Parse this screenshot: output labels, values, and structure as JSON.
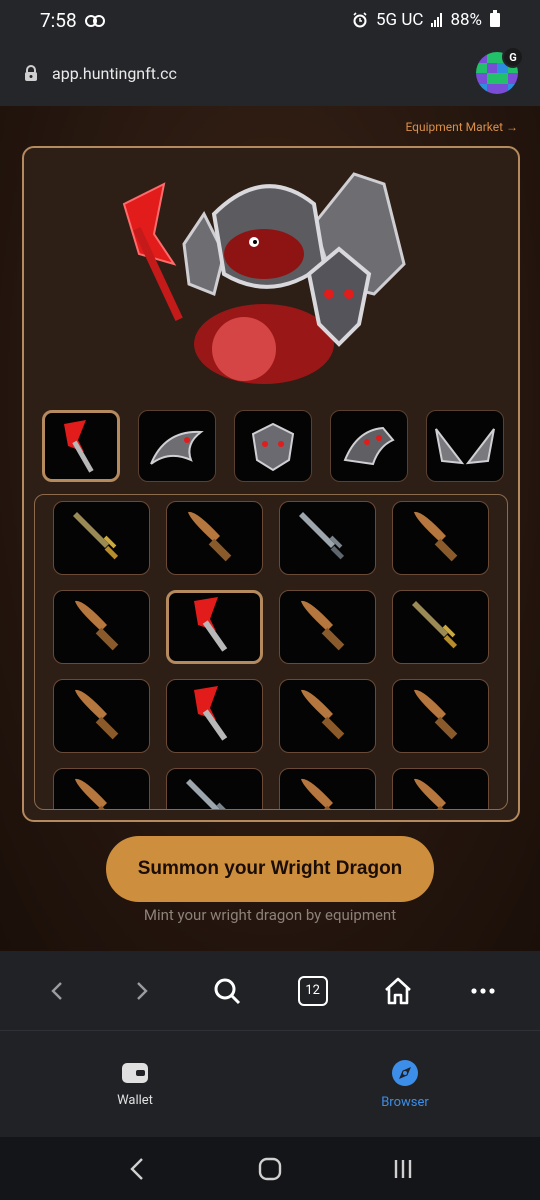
{
  "status_bar": {
    "time": "7:58",
    "network": "5G UC",
    "battery": "88%"
  },
  "address_bar": {
    "url": "app.huntingnft.cc",
    "avatar_badge": "G"
  },
  "page": {
    "market_link": "Equipment Market →",
    "slots": [
      {
        "item": "red-axe-icon",
        "selected": true
      },
      {
        "item": "tail-armor-icon",
        "selected": false
      },
      {
        "item": "chest-armor-icon",
        "selected": false
      },
      {
        "item": "claw-armor-icon",
        "selected": false
      },
      {
        "item": "wings-icon",
        "selected": false
      }
    ],
    "inventory": [
      "gold-sword-icon",
      "wooden-sword-icon",
      "steel-sword-icon",
      "wooden-sword-icon",
      "wooden-sword-icon",
      "red-axe-icon",
      "wooden-sword-icon",
      "gold-sword-icon",
      "wooden-sword-icon",
      "red-axe-icon",
      "wooden-sword-icon",
      "wooden-sword-icon",
      "wooden-sword-icon",
      "steel-sword-icon",
      "wooden-sword-icon",
      "wooden-sword-icon"
    ],
    "selected_inventory_index": 5,
    "summon_button": "Summon your Wright Dragon",
    "subtitle": "Mint your wright dragon by equipment"
  },
  "browser_nav": {
    "tab_count": "12"
  },
  "bottom_tabs": [
    {
      "label": "Wallet",
      "icon": "wallet-icon",
      "active": false
    },
    {
      "label": "Browser",
      "icon": "compass-icon",
      "active": true
    }
  ],
  "colors": {
    "accent": "#cd8f3d",
    "panel_border": "#b48a5e",
    "link": "#d9904a",
    "active_tab": "#3d8ee8"
  }
}
